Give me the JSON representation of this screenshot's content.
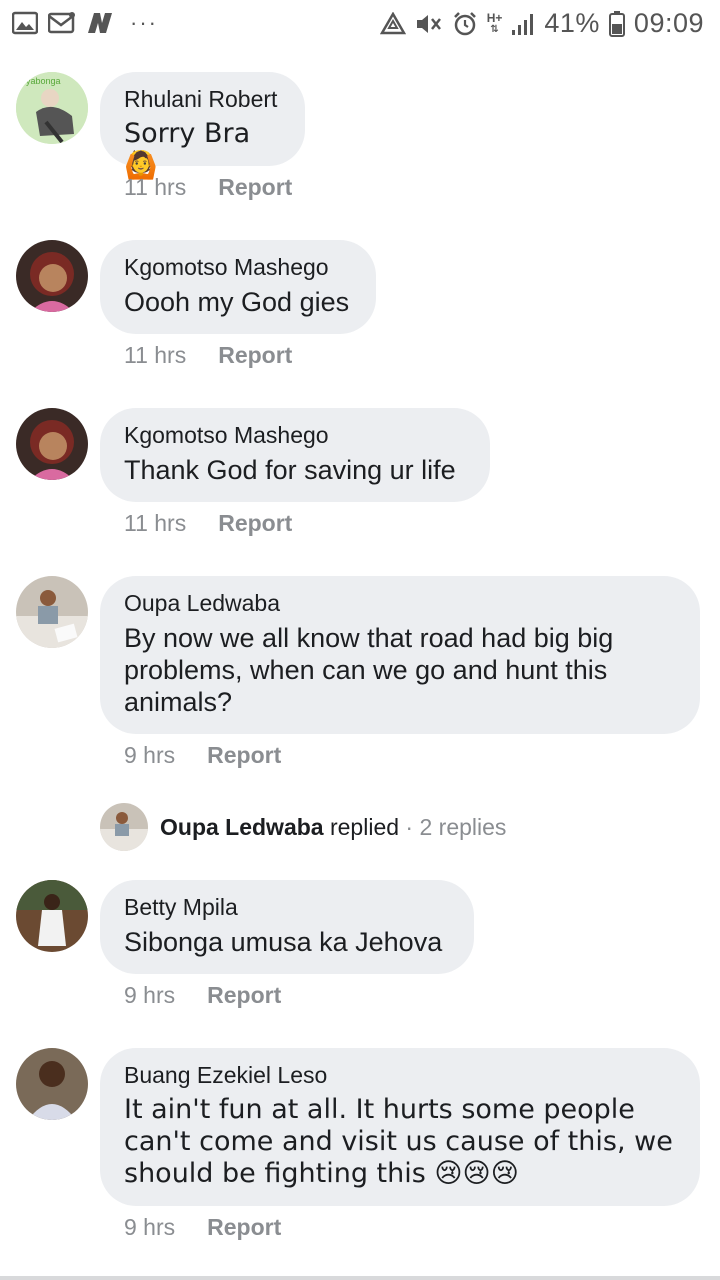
{
  "status_bar": {
    "battery_percent": "41%",
    "time": "09:09",
    "network": "H+",
    "more": "···",
    "icons": [
      "gallery-icon",
      "mail-icon",
      "news-icon",
      "recycle-icon",
      "mute-icon",
      "alarm-icon",
      "signal-icon",
      "battery-icon"
    ]
  },
  "comments": [
    {
      "author": "Rhulani Robert",
      "text": "Sorry Bra 🙆",
      "time": "11 hrs",
      "report": "Report"
    },
    {
      "author": "Kgomotso Mashego",
      "text": "Oooh my God gies",
      "time": "11 hrs",
      "report": "Report"
    },
    {
      "author": "Kgomotso Mashego",
      "text": "Thank God for saving ur life",
      "time": "11 hrs",
      "report": "Report"
    },
    {
      "author": "Oupa Ledwaba",
      "text": "By now we all know that road had big big problems, when can we go and hunt this animals?",
      "time": "9 hrs",
      "report": "Report"
    },
    {
      "author": "Betty Mpila",
      "text": "Sibonga umusa ka Jehova",
      "time": "9 hrs",
      "report": "Report"
    },
    {
      "author": "Buang Ezekiel Leso",
      "text": "It ain't fun at all. It hurts some people can't come and visit us cause of this, we should be fighting this 😢😢😢",
      "time": "9 hrs",
      "report": "Report"
    }
  ],
  "reply_summary": {
    "author": "Oupa Ledwaba",
    "action": "replied",
    "separator": "·",
    "count": "2 replies"
  },
  "avatar_logo_text": "yabonga"
}
